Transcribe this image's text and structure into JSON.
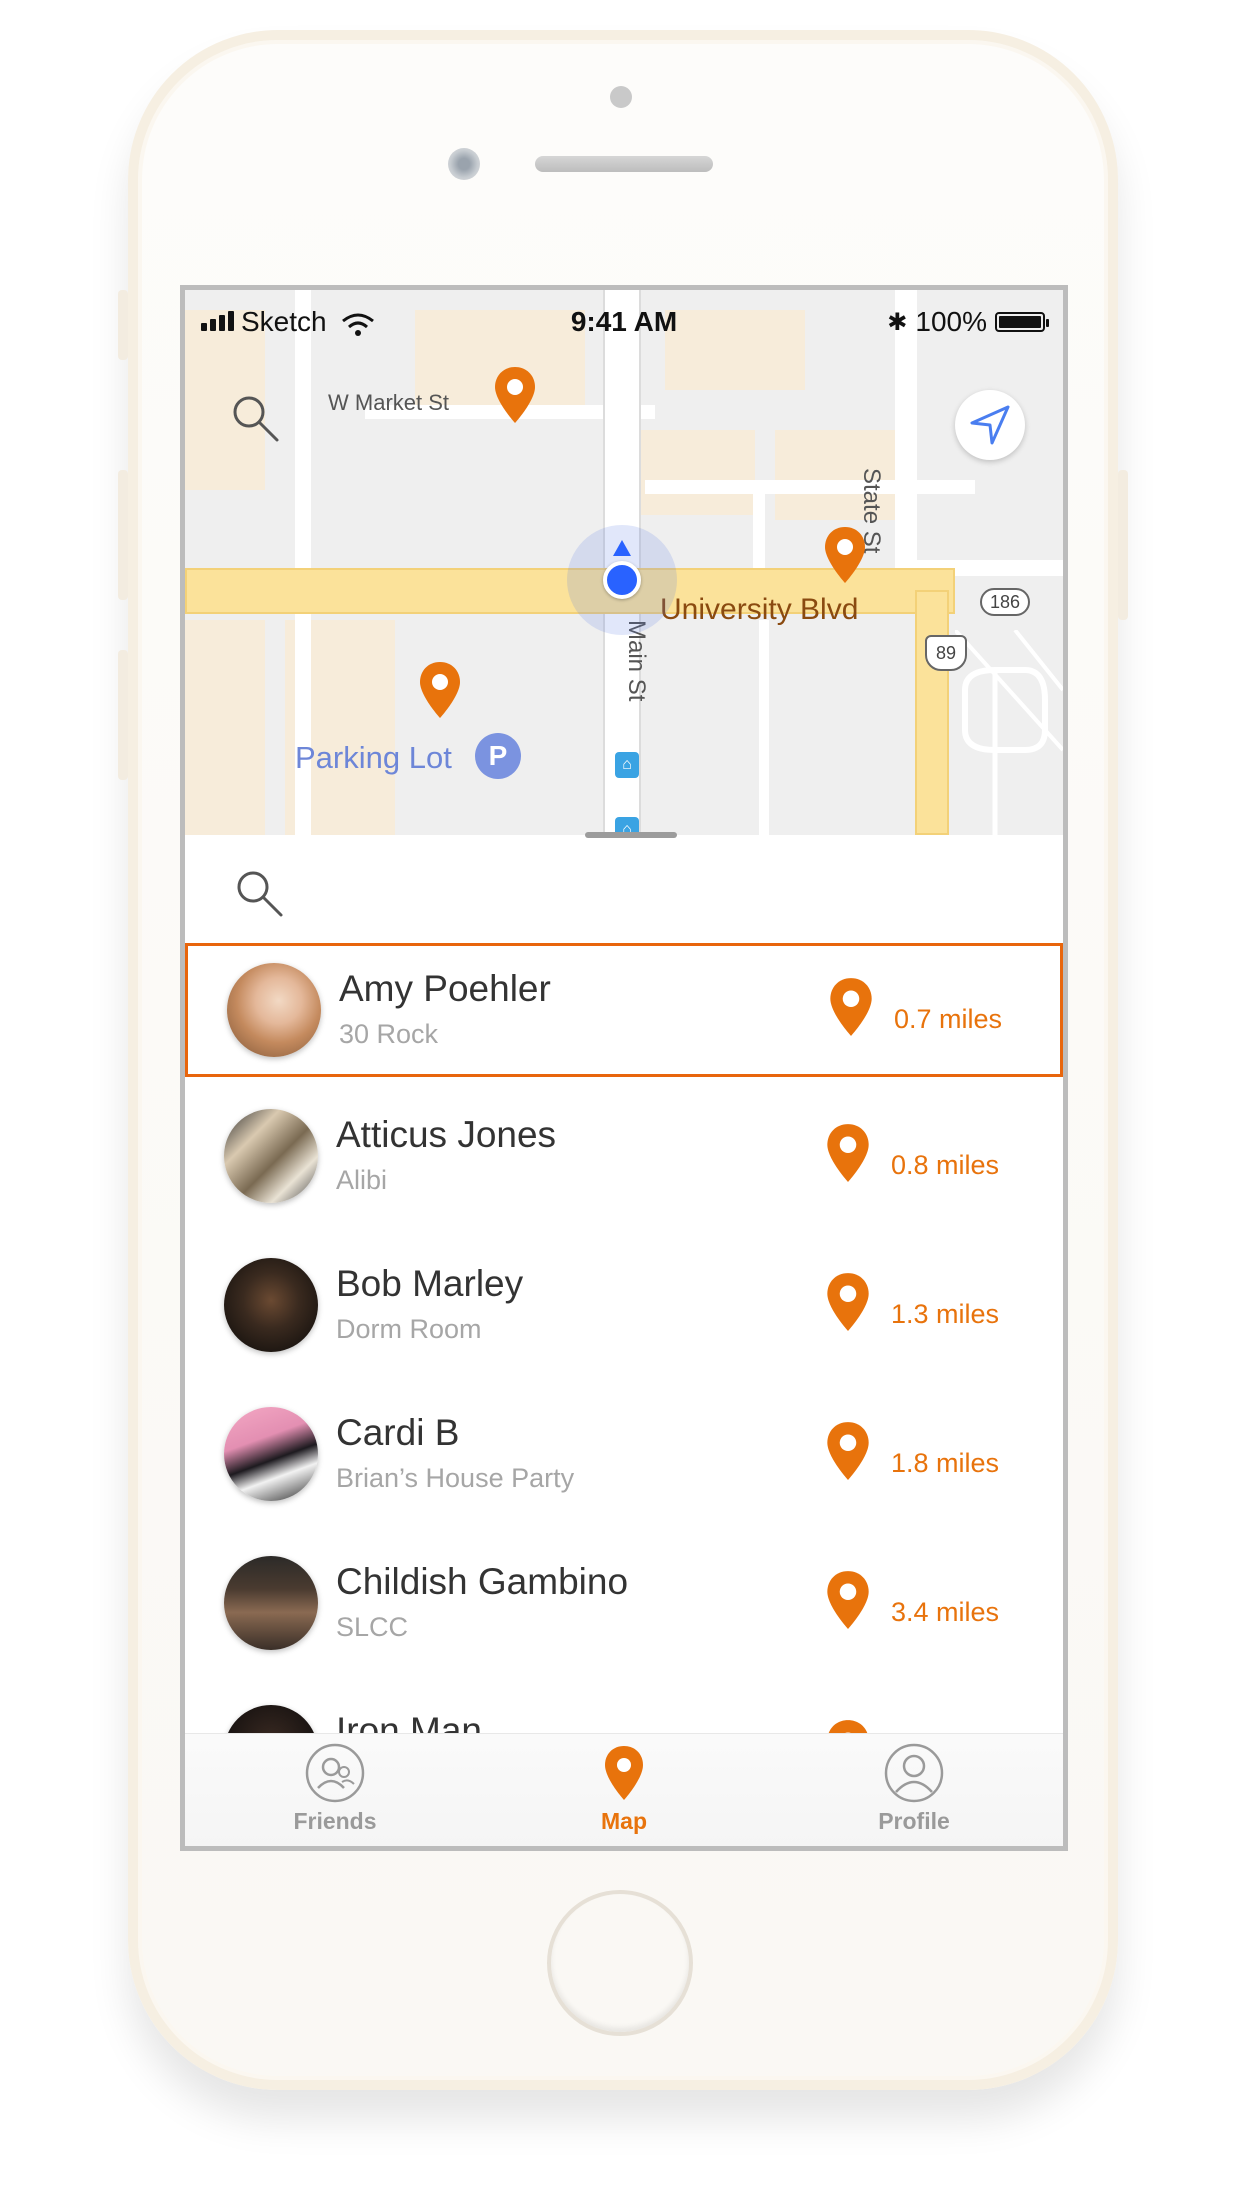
{
  "status_bar": {
    "carrier": "Sketch",
    "time": "9:41 AM",
    "battery": "100%"
  },
  "map": {
    "labels": {
      "w_market": "W Market St",
      "state_st": "State St",
      "university": "University Blvd",
      "main_st": "Main St",
      "parking": "Parking Lot",
      "route_186": "186",
      "route_89": "89",
      "parking_symbol": "P"
    }
  },
  "friends": [
    {
      "name": "Amy Poehler",
      "place": "30 Rock",
      "distance": "0.7 miles",
      "selected": true
    },
    {
      "name": "Atticus Jones",
      "place": "Alibi",
      "distance": "0.8 miles",
      "selected": false
    },
    {
      "name": "Bob Marley",
      "place": "Dorm Room",
      "distance": "1.3 miles",
      "selected": false
    },
    {
      "name": "Cardi B",
      "place": "Brian’s House Party",
      "distance": "1.8 miles",
      "selected": false
    },
    {
      "name": "Childish Gambino",
      "place": "SLCC",
      "distance": "3.4 miles",
      "selected": false
    },
    {
      "name": "Iron Man",
      "place": "",
      "distance": "",
      "selected": false
    }
  ],
  "tabs": [
    {
      "label": "Friends",
      "icon": "friends-icon",
      "active": false
    },
    {
      "label": "Map",
      "icon": "map-pin-icon",
      "active": true
    },
    {
      "label": "Profile",
      "icon": "profile-icon",
      "active": false
    }
  ],
  "colors": {
    "accent": "#e8730c",
    "selection_border": "#e8650c",
    "user_location": "#2962ff",
    "locate_arrow": "#4a7ef0"
  }
}
